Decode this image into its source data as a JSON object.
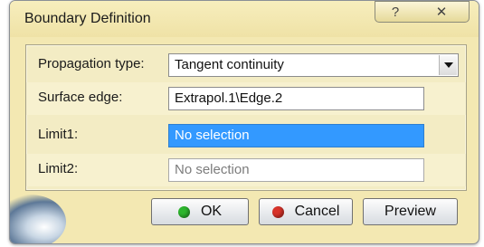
{
  "window": {
    "title": "Boundary Definition",
    "help_glyph": "?",
    "close_glyph": "✕"
  },
  "form": {
    "propagation_label": "Propagation type:",
    "propagation_value": "Tangent continuity",
    "surface_edge_label": "Surface edge:",
    "surface_edge_value": "Extrapol.1\\Edge.2",
    "limit1_label": "Limit1:",
    "limit1_value": "No selection",
    "limit2_label": "Limit2:",
    "limit2_value": "No selection"
  },
  "buttons": {
    "ok_label": "OK",
    "cancel_label": "Cancel",
    "preview_label": "Preview"
  },
  "colors": {
    "ok_dot": "#2db52d",
    "cancel_dot": "#d8332a",
    "selection": "#3399ff",
    "dialog_bg": "#f3e8b2"
  }
}
